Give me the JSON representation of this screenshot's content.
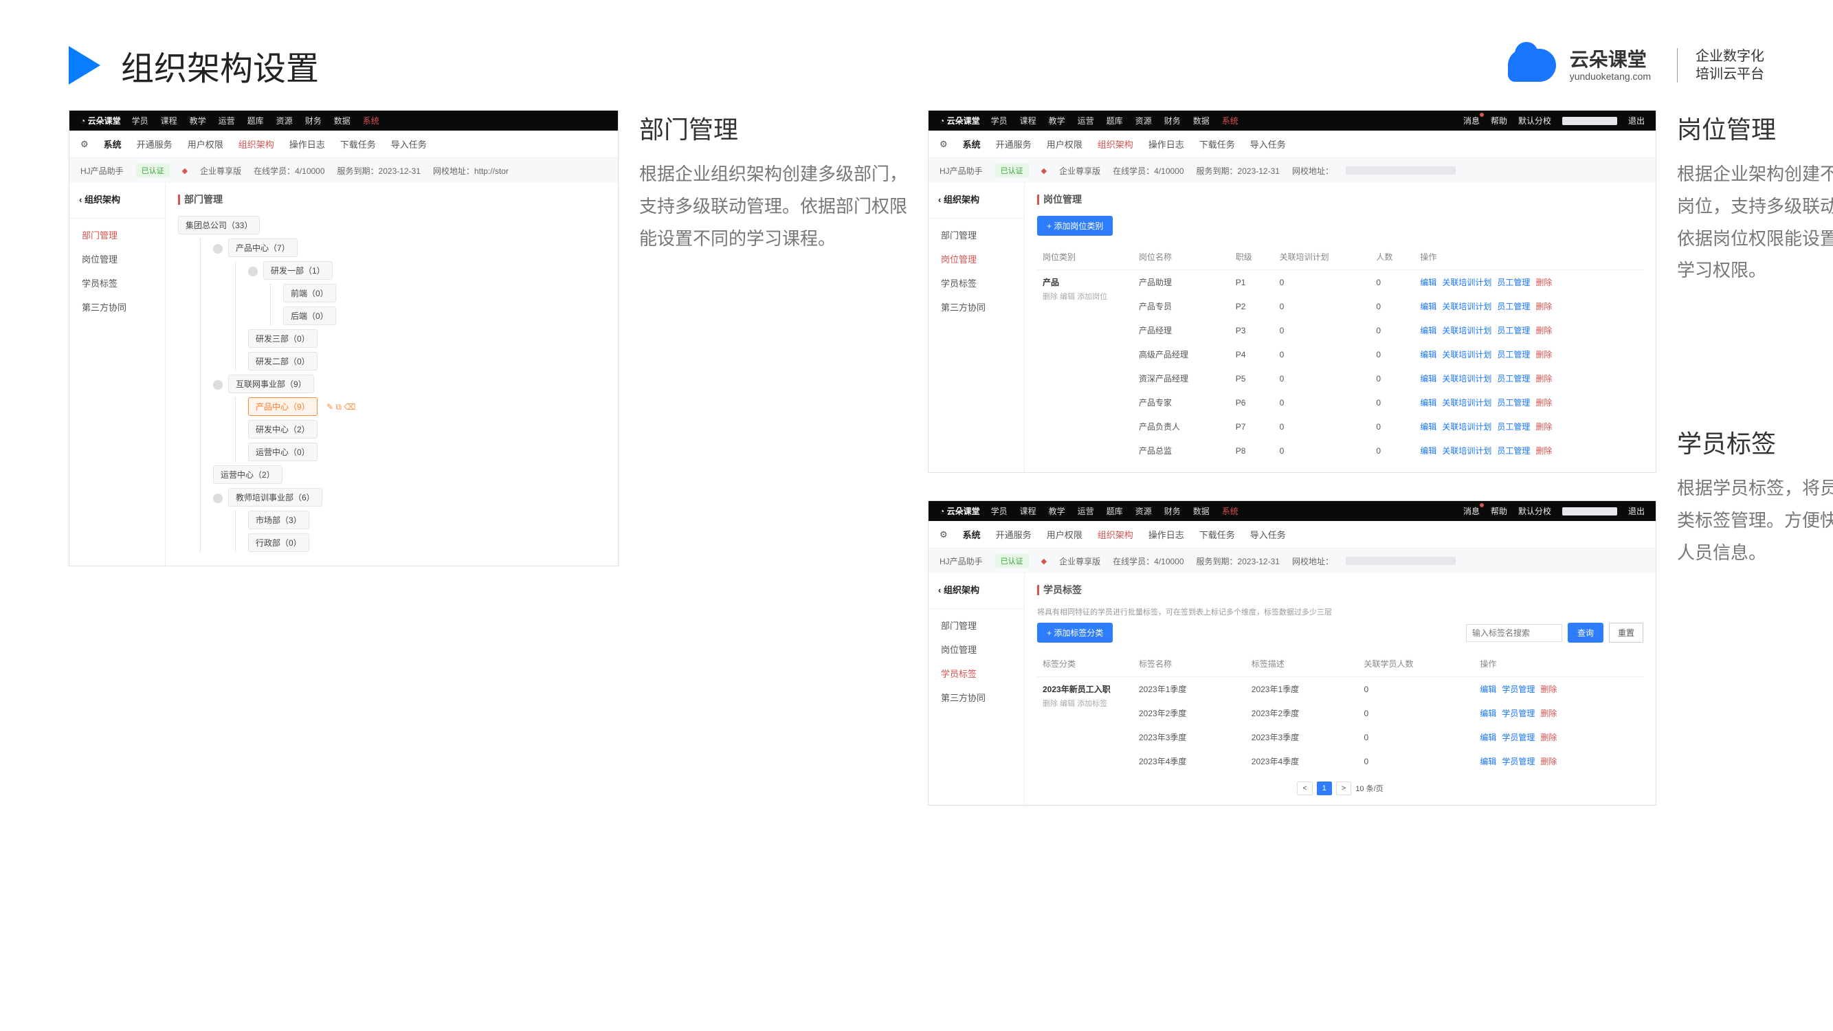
{
  "header": {
    "title": "组织架构设置"
  },
  "brand": {
    "name": "云朵课堂",
    "url": "yunduoketang.com",
    "slogan1": "企业数字化",
    "slogan2": "培训云平台"
  },
  "sections": {
    "dept": {
      "title": "部门管理",
      "desc": "根据企业组织架构创建多级部门，支持多级联动管理。依据部门权限能设置不同的学习课程。"
    },
    "role": {
      "title": "岗位管理",
      "desc": "根据企业架构创建不同职级岗位，支持多级联动管理。依据岗位权限能设置不同的学习权限。"
    },
    "tag": {
      "title": "学员标签",
      "desc": "根据学员标签，将员工分多类标签管理。方便快捷查找人员信息。"
    }
  },
  "topnav": [
    "学员",
    "课程",
    "教学",
    "运营",
    "题库",
    "资源",
    "财务",
    "数据",
    "系统"
  ],
  "subnav": {
    "sys": "系统",
    "items": [
      "开通服务",
      "用户权限",
      "组织架构",
      "操作日志",
      "下载任务",
      "导入任务"
    ],
    "activeIndex": 2
  },
  "info": {
    "prefix": "HJ产品助手",
    "cert": "已认证",
    "plan": "企业尊享版",
    "online": "在线学员：4/10000",
    "expire": "服务到期：2023-12-31",
    "site": "网校地址：http://stor"
  },
  "crumb": "组织架构",
  "sideitems": [
    "部门管理",
    "岗位管理",
    "学员标签",
    "第三方协同"
  ],
  "deptTree": {
    "title": "部门管理",
    "root": "集团总公司（33）",
    "n1": "产品中心（7）",
    "n1a": "研发一部（1）",
    "n1a1": "前端（0）",
    "n1a2": "后端（0）",
    "n1b": "研发三部（0）",
    "n1c": "研发二部（0）",
    "n2": "互联网事业部（9）",
    "n2a": "产品中心（9）",
    "n2b": "研发中心（2）",
    "n2c": "运营中心（0）",
    "n3": "运营中心（2）",
    "n4": "教师培训事业部（6）",
    "n4a": "市场部（3）",
    "n4b": "行政部（0）"
  },
  "role": {
    "title": "岗位管理",
    "addBtn": "+ 添加岗位类别",
    "cols": [
      "岗位类别",
      "岗位名称",
      "职级",
      "关联培训计划",
      "人数",
      "操作"
    ],
    "groupTitle": "产品",
    "groupOps": "删除  编辑  添加岗位",
    "rows": [
      {
        "name": "产品助理",
        "lvl": "P1",
        "plan": "0",
        "num": "0"
      },
      {
        "name": "产品专员",
        "lvl": "P2",
        "plan": "0",
        "num": "0"
      },
      {
        "name": "产品经理",
        "lvl": "P3",
        "plan": "0",
        "num": "0"
      },
      {
        "name": "高级产品经理",
        "lvl": "P4",
        "plan": "0",
        "num": "0"
      },
      {
        "name": "资深产品经理",
        "lvl": "P5",
        "plan": "0",
        "num": "0"
      },
      {
        "name": "产品专家",
        "lvl": "P6",
        "plan": "0",
        "num": "0"
      },
      {
        "name": "产品负责人",
        "lvl": "P7",
        "plan": "0",
        "num": "0"
      },
      {
        "name": "产品总监",
        "lvl": "P8",
        "plan": "0",
        "num": "0"
      }
    ],
    "ops": {
      "a": "编辑",
      "b": "关联培训计划",
      "c": "员工管理",
      "d": "删除"
    }
  },
  "tag": {
    "title": "学员标签",
    "hint": "将具有相同特征的学员进行批量标签，可在签到表上标记多个维度，标签数据过多少三层",
    "addBtn": "+ 添加标签分类",
    "searchPh": "输入标签名搜索",
    "searchBtn": "查询",
    "resetBtn": "重置",
    "cols": [
      "标签分类",
      "标签名称",
      "标签描述",
      "关联学员人数",
      "操作"
    ],
    "groupTitle": "2023年新员工入职",
    "groupOps": "删除  编辑  添加标签",
    "rows": [
      {
        "name": "2023年1季度",
        "desc": "2023年1季度",
        "num": "0"
      },
      {
        "name": "2023年2季度",
        "desc": "2023年2季度",
        "num": "0"
      },
      {
        "name": "2023年3季度",
        "desc": "2023年3季度",
        "num": "0"
      },
      {
        "name": "2023年4季度",
        "desc": "2023年4季度",
        "num": "0"
      }
    ],
    "ops": {
      "a": "编辑",
      "b": "学员管理",
      "c": "删除"
    },
    "pager": {
      "prev": "<",
      "cur": "1",
      "next": ">",
      "size": "10 条/页"
    }
  },
  "tailnav": {
    "msg": "消息",
    "help": "帮助",
    "branch": "默认分校",
    "exit": "退出"
  }
}
